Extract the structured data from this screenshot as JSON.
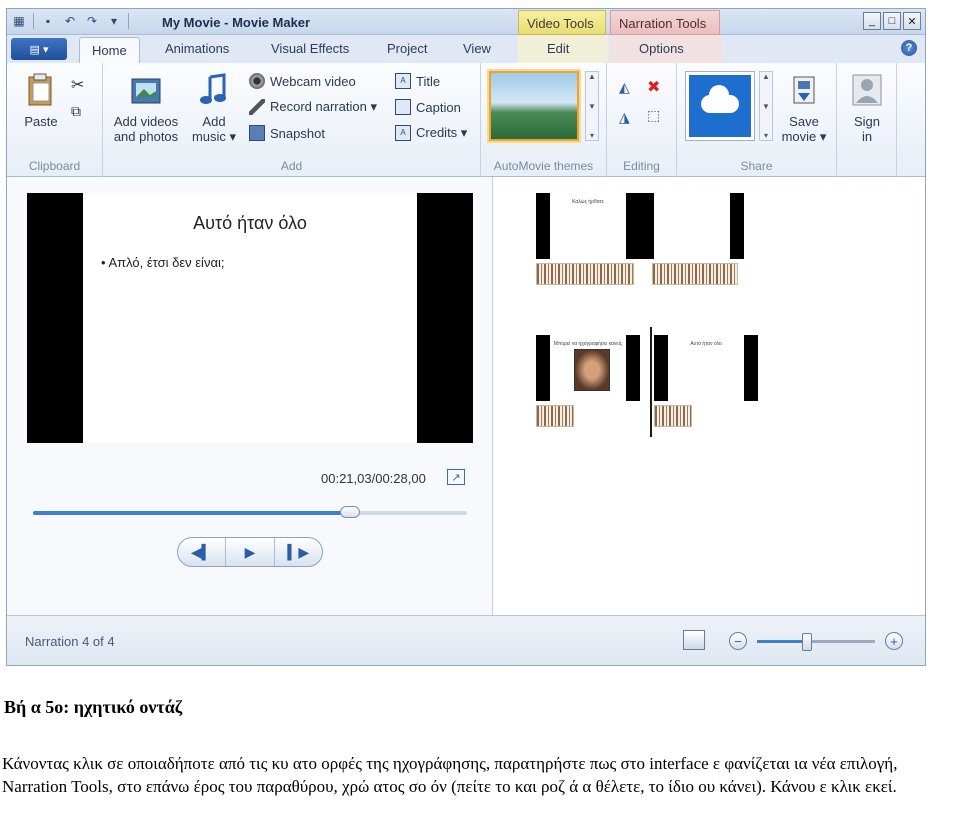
{
  "window": {
    "title": "My Movie - Movie Maker",
    "context_tabs": {
      "video_tools": "Video Tools",
      "narration_tools": "Narration Tools"
    },
    "controls": {
      "minimize": "_",
      "maximize": "□",
      "close": "✕"
    }
  },
  "tabs": {
    "file_menu": "▤ ▾",
    "items": [
      "Home",
      "Animations",
      "Visual Effects",
      "Project",
      "View"
    ],
    "context_items": {
      "edit": "Edit",
      "options": "Options"
    },
    "active": "Home"
  },
  "ribbon": {
    "clipboard": {
      "label": "Clipboard",
      "paste": "Paste"
    },
    "add": {
      "label": "Add",
      "add_videos_1": "Add videos",
      "add_videos_2": "and photos",
      "add_music_1": "Add",
      "add_music_2": "music ▾",
      "webcam_video": "Webcam video",
      "record_narration": "Record narration ▾",
      "snapshot": "Snapshot",
      "title": "Title",
      "caption": "Caption",
      "credits": "Credits ▾"
    },
    "automovie": {
      "label": "AutoMovie themes"
    },
    "editing": {
      "label": "Editing"
    },
    "share": {
      "label": "Share",
      "save_movie_1": "Save",
      "save_movie_2": "movie ▾",
      "sign_in_1": "Sign",
      "sign_in_2": "in"
    }
  },
  "preview": {
    "slide_title": "Αυτό ήταν όλο",
    "slide_bullet": "•  Απλό, έτσι δεν είναι;",
    "timecode": "00:21,03/00:28,00",
    "seek_progress": 0.73,
    "transport": {
      "prev": "◀▍",
      "play": "▶",
      "next": "▍▶"
    }
  },
  "storyboard": {
    "clips": [
      {
        "title": "Καλώς ήρθατε"
      },
      {
        "title": ""
      },
      {
        "title": "Μπορεί να ηχογραφήσει κανείς"
      },
      {
        "title": "Αυτό ήταν όλο"
      }
    ]
  },
  "statusbar": {
    "text": "Narration 4 of 4",
    "zoom_minus": "−",
    "zoom_plus": "+",
    "zoom_level": 0.42
  },
  "document": {
    "heading": "Βή  α 5ο: ηχητικό   οντάζ",
    "paragraph": "Κάνοντας κλικ σε οποιαδήποτε από τις κυ  ατο  ορφές της ηχογράφησης, παρατηρήστε πως στο interface ε  φανίζεται   ια νέα επιλογή, Narration Tools, στο επάνω   έρος του παραθύρου, χρώ  ατος σο  όν (πείτε το και ροζ ά  α θέλετε, το ίδιο   ου κάνει). Κάνου  ε κλικ εκεί."
  },
  "colors": {
    "video_tools": "#e9dc72",
    "narration_tools": "#ebbdbd",
    "accent_blue": "#3f7fd0"
  }
}
